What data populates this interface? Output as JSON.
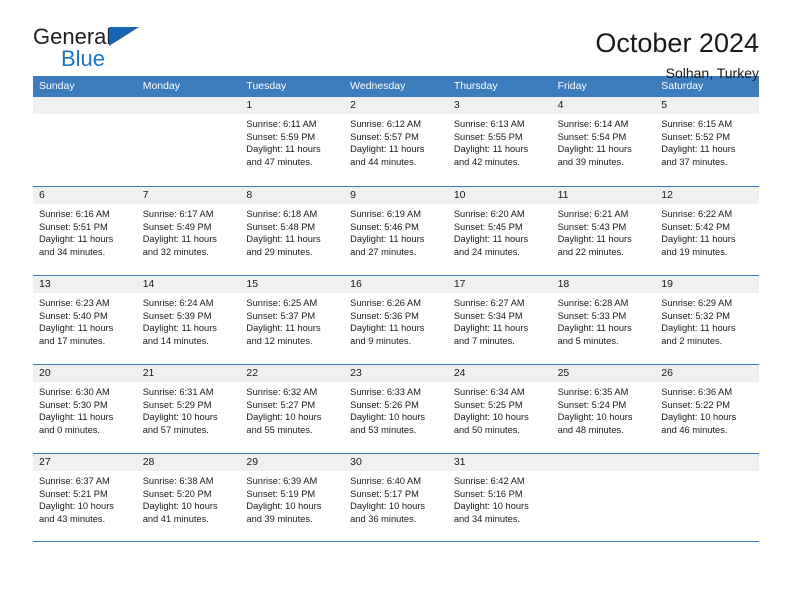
{
  "logo": {
    "word_top": "General",
    "word_bottom": "Blue",
    "triangle_color": "#1565b5",
    "blue_color": "#1b76c4"
  },
  "header": {
    "title": "October 2024",
    "subtitle": "Solhan, Turkey"
  },
  "theme": {
    "header_blue": "#3c7cbd",
    "daynum_gray": "#f0f0f0",
    "text": "#1a1a1a"
  },
  "weekdays": [
    "Sunday",
    "Monday",
    "Tuesday",
    "Wednesday",
    "Thursday",
    "Friday",
    "Saturday"
  ],
  "weeks": [
    [
      {
        "day": "",
        "empty": true
      },
      {
        "day": "",
        "empty": true
      },
      {
        "day": "1",
        "sunrise": "Sunrise: 6:11 AM",
        "sunset": "Sunset: 5:59 PM",
        "daylight": "Daylight: 11 hours and 47 minutes."
      },
      {
        "day": "2",
        "sunrise": "Sunrise: 6:12 AM",
        "sunset": "Sunset: 5:57 PM",
        "daylight": "Daylight: 11 hours and 44 minutes."
      },
      {
        "day": "3",
        "sunrise": "Sunrise: 6:13 AM",
        "sunset": "Sunset: 5:55 PM",
        "daylight": "Daylight: 11 hours and 42 minutes."
      },
      {
        "day": "4",
        "sunrise": "Sunrise: 6:14 AM",
        "sunset": "Sunset: 5:54 PM",
        "daylight": "Daylight: 11 hours and 39 minutes."
      },
      {
        "day": "5",
        "sunrise": "Sunrise: 6:15 AM",
        "sunset": "Sunset: 5:52 PM",
        "daylight": "Daylight: 11 hours and 37 minutes."
      }
    ],
    [
      {
        "day": "6",
        "sunrise": "Sunrise: 6:16 AM",
        "sunset": "Sunset: 5:51 PM",
        "daylight": "Daylight: 11 hours and 34 minutes."
      },
      {
        "day": "7",
        "sunrise": "Sunrise: 6:17 AM",
        "sunset": "Sunset: 5:49 PM",
        "daylight": "Daylight: 11 hours and 32 minutes."
      },
      {
        "day": "8",
        "sunrise": "Sunrise: 6:18 AM",
        "sunset": "Sunset: 5:48 PM",
        "daylight": "Daylight: 11 hours and 29 minutes."
      },
      {
        "day": "9",
        "sunrise": "Sunrise: 6:19 AM",
        "sunset": "Sunset: 5:46 PM",
        "daylight": "Daylight: 11 hours and 27 minutes."
      },
      {
        "day": "10",
        "sunrise": "Sunrise: 6:20 AM",
        "sunset": "Sunset: 5:45 PM",
        "daylight": "Daylight: 11 hours and 24 minutes."
      },
      {
        "day": "11",
        "sunrise": "Sunrise: 6:21 AM",
        "sunset": "Sunset: 5:43 PM",
        "daylight": "Daylight: 11 hours and 22 minutes."
      },
      {
        "day": "12",
        "sunrise": "Sunrise: 6:22 AM",
        "sunset": "Sunset: 5:42 PM",
        "daylight": "Daylight: 11 hours and 19 minutes."
      }
    ],
    [
      {
        "day": "13",
        "sunrise": "Sunrise: 6:23 AM",
        "sunset": "Sunset: 5:40 PM",
        "daylight": "Daylight: 11 hours and 17 minutes."
      },
      {
        "day": "14",
        "sunrise": "Sunrise: 6:24 AM",
        "sunset": "Sunset: 5:39 PM",
        "daylight": "Daylight: 11 hours and 14 minutes."
      },
      {
        "day": "15",
        "sunrise": "Sunrise: 6:25 AM",
        "sunset": "Sunset: 5:37 PM",
        "daylight": "Daylight: 11 hours and 12 minutes."
      },
      {
        "day": "16",
        "sunrise": "Sunrise: 6:26 AM",
        "sunset": "Sunset: 5:36 PM",
        "daylight": "Daylight: 11 hours and 9 minutes."
      },
      {
        "day": "17",
        "sunrise": "Sunrise: 6:27 AM",
        "sunset": "Sunset: 5:34 PM",
        "daylight": "Daylight: 11 hours and 7 minutes."
      },
      {
        "day": "18",
        "sunrise": "Sunrise: 6:28 AM",
        "sunset": "Sunset: 5:33 PM",
        "daylight": "Daylight: 11 hours and 5 minutes."
      },
      {
        "day": "19",
        "sunrise": "Sunrise: 6:29 AM",
        "sunset": "Sunset: 5:32 PM",
        "daylight": "Daylight: 11 hours and 2 minutes."
      }
    ],
    [
      {
        "day": "20",
        "sunrise": "Sunrise: 6:30 AM",
        "sunset": "Sunset: 5:30 PM",
        "daylight": "Daylight: 11 hours and 0 minutes."
      },
      {
        "day": "21",
        "sunrise": "Sunrise: 6:31 AM",
        "sunset": "Sunset: 5:29 PM",
        "daylight": "Daylight: 10 hours and 57 minutes."
      },
      {
        "day": "22",
        "sunrise": "Sunrise: 6:32 AM",
        "sunset": "Sunset: 5:27 PM",
        "daylight": "Daylight: 10 hours and 55 minutes."
      },
      {
        "day": "23",
        "sunrise": "Sunrise: 6:33 AM",
        "sunset": "Sunset: 5:26 PM",
        "daylight": "Daylight: 10 hours and 53 minutes."
      },
      {
        "day": "24",
        "sunrise": "Sunrise: 6:34 AM",
        "sunset": "Sunset: 5:25 PM",
        "daylight": "Daylight: 10 hours and 50 minutes."
      },
      {
        "day": "25",
        "sunrise": "Sunrise: 6:35 AM",
        "sunset": "Sunset: 5:24 PM",
        "daylight": "Daylight: 10 hours and 48 minutes."
      },
      {
        "day": "26",
        "sunrise": "Sunrise: 6:36 AM",
        "sunset": "Sunset: 5:22 PM",
        "daylight": "Daylight: 10 hours and 46 minutes."
      }
    ],
    [
      {
        "day": "27",
        "sunrise": "Sunrise: 6:37 AM",
        "sunset": "Sunset: 5:21 PM",
        "daylight": "Daylight: 10 hours and 43 minutes."
      },
      {
        "day": "28",
        "sunrise": "Sunrise: 6:38 AM",
        "sunset": "Sunset: 5:20 PM",
        "daylight": "Daylight: 10 hours and 41 minutes."
      },
      {
        "day": "29",
        "sunrise": "Sunrise: 6:39 AM",
        "sunset": "Sunset: 5:19 PM",
        "daylight": "Daylight: 10 hours and 39 minutes."
      },
      {
        "day": "30",
        "sunrise": "Sunrise: 6:40 AM",
        "sunset": "Sunset: 5:17 PM",
        "daylight": "Daylight: 10 hours and 36 minutes."
      },
      {
        "day": "31",
        "sunrise": "Sunrise: 6:42 AM",
        "sunset": "Sunset: 5:16 PM",
        "daylight": "Daylight: 10 hours and 34 minutes."
      },
      {
        "day": "",
        "empty": true
      },
      {
        "day": "",
        "empty": true
      }
    ]
  ]
}
